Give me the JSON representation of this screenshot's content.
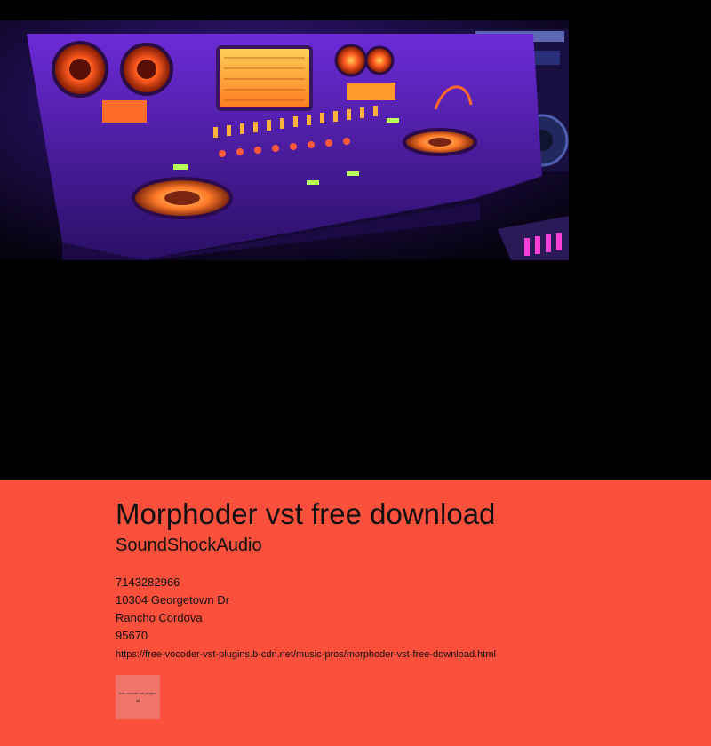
{
  "hero": {
    "image_alt": "Synthesizer mixing console"
  },
  "footer": {
    "title": "Morphoder vst free download",
    "brand": "SoundShockAudio",
    "phone": "7143282966",
    "street": "10304 Georgetown Dr",
    "city": "Rancho Cordova",
    "zip": "95670",
    "url": "https://free-vocoder-vst-plugins.b-cdn.net/music-pros/morphoder-vst-free-download.html",
    "thumbnail": {
      "caption": "free vocoder vst plugins",
      "mark": "sl"
    }
  },
  "colors": {
    "page_background": "#000000",
    "footer_background": "#fb503b",
    "text": "#111111"
  }
}
